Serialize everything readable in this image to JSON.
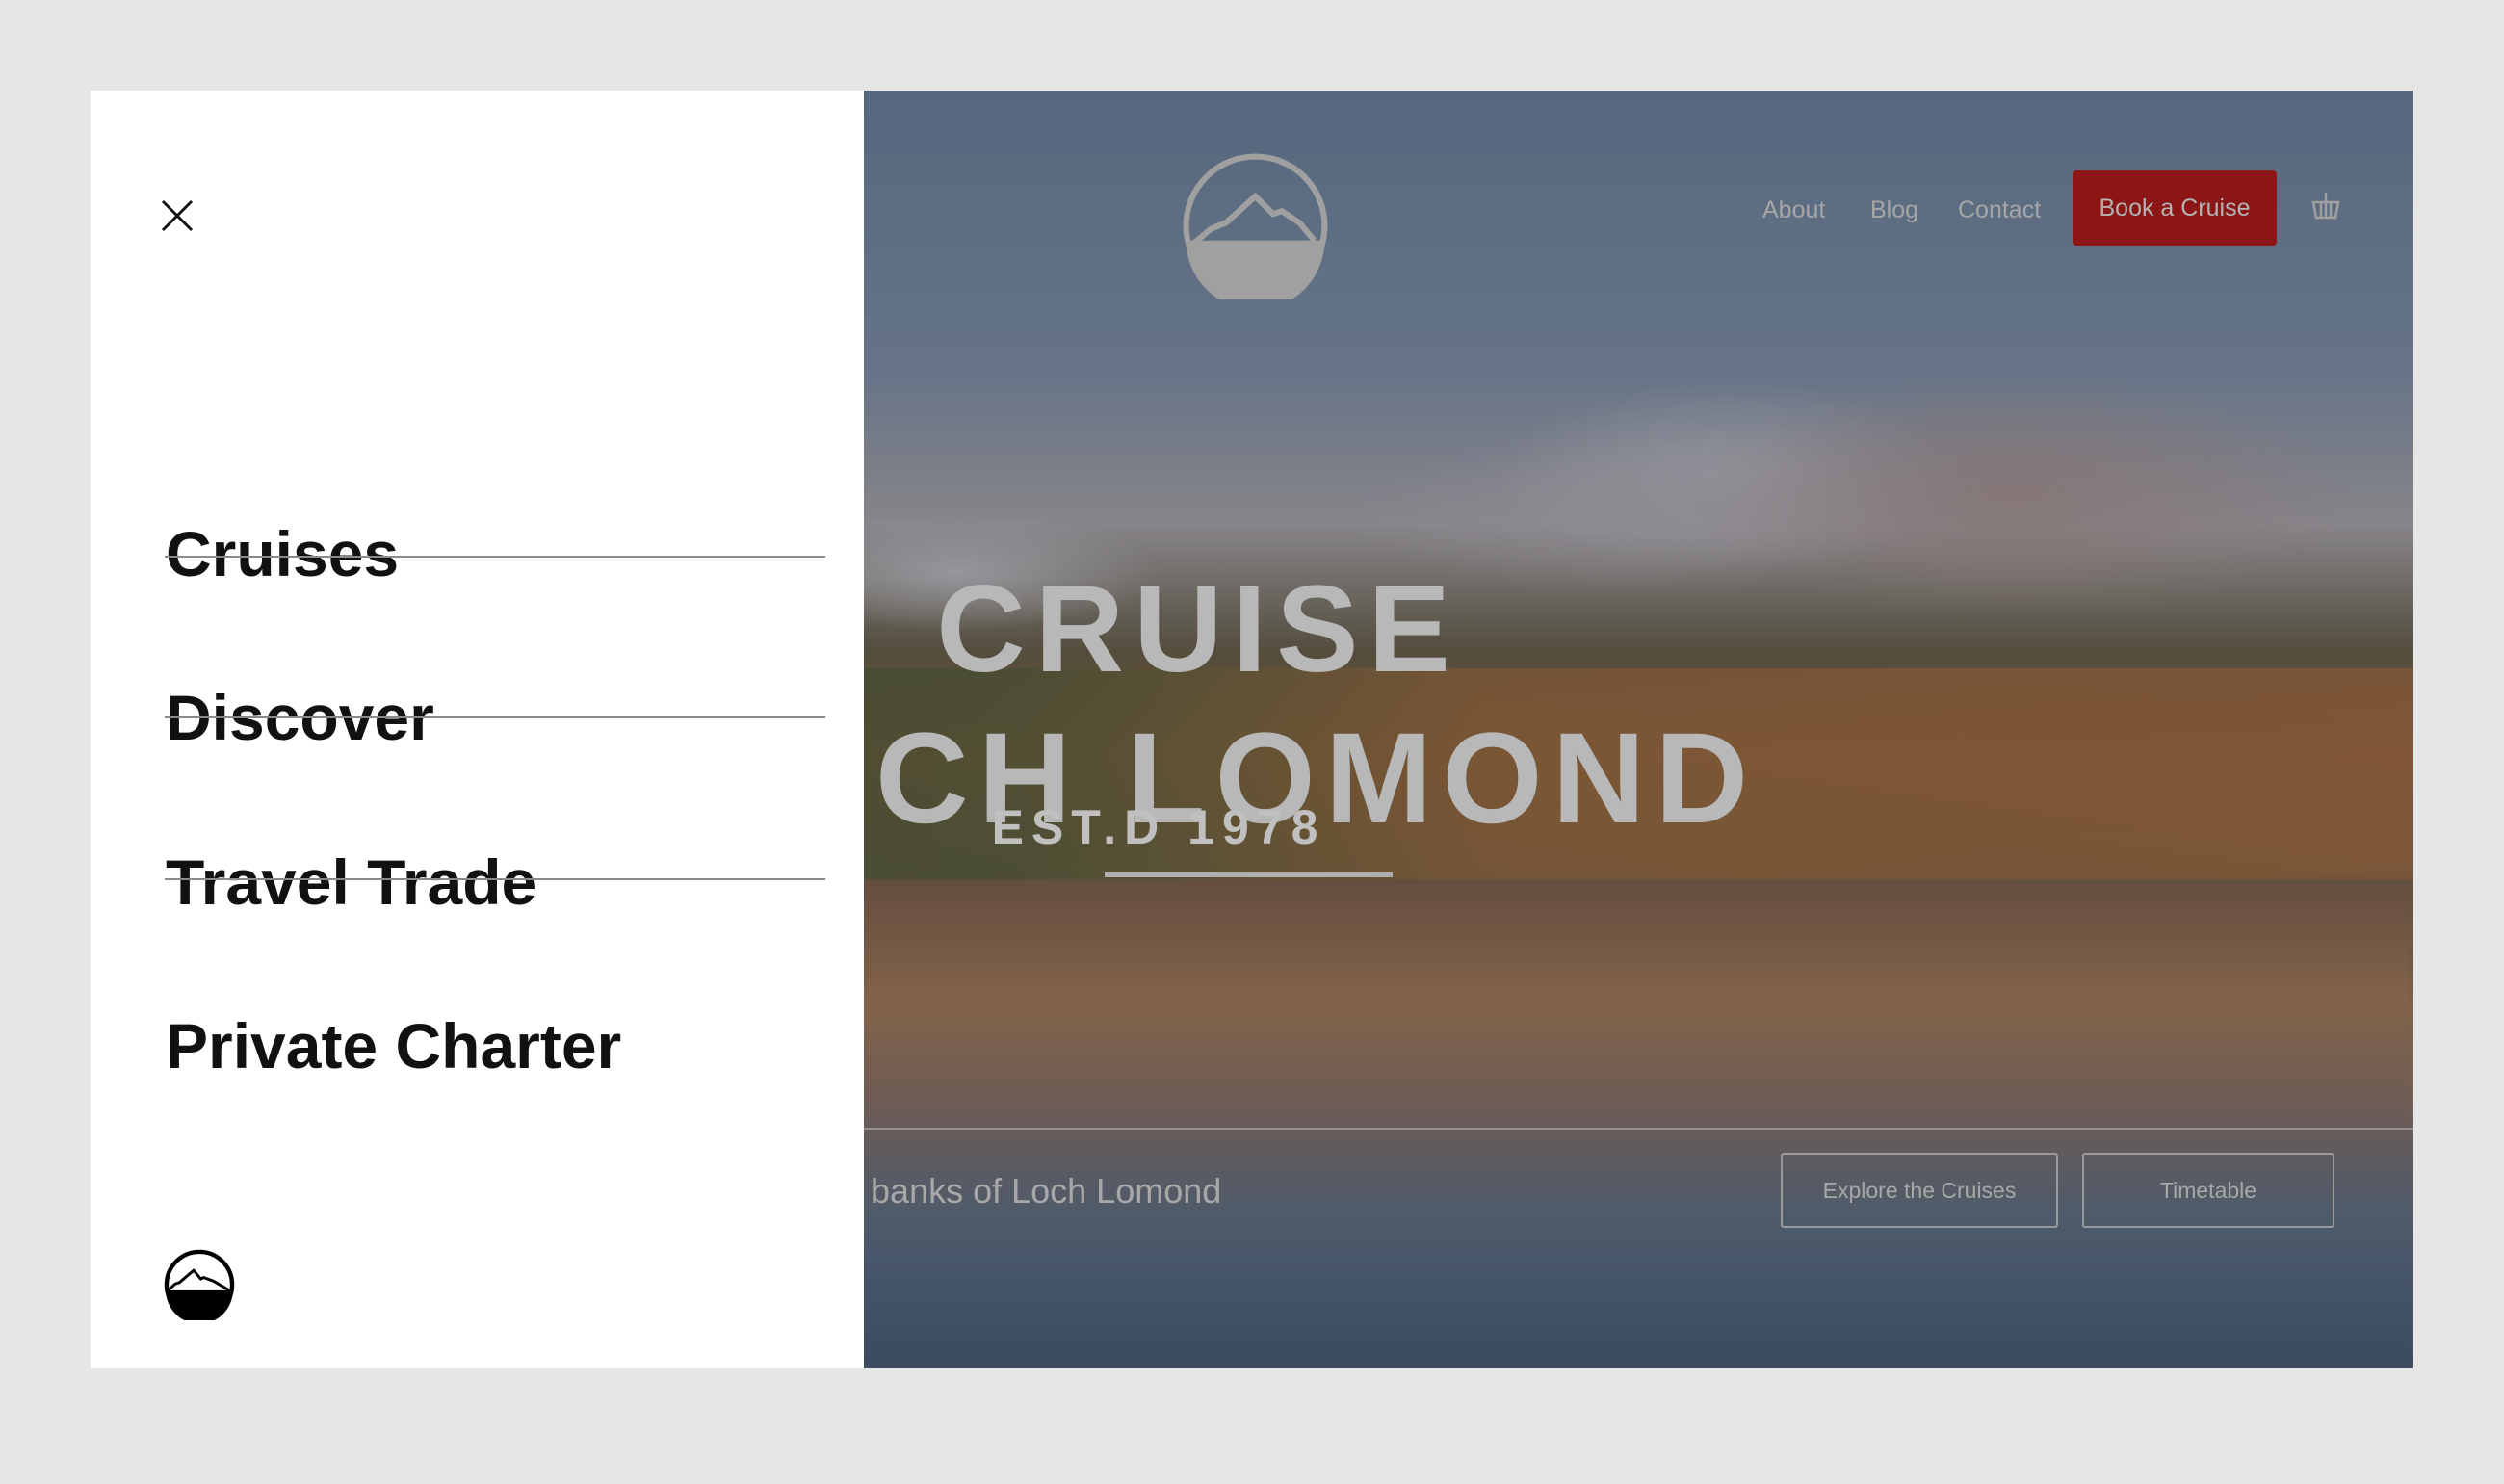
{
  "menu": {
    "items": [
      {
        "label": "Cruises"
      },
      {
        "label": "Discover"
      },
      {
        "label": "Travel Trade"
      },
      {
        "label": "Private Charter"
      }
    ]
  },
  "nav": {
    "about": "About",
    "blog": "Blog",
    "contact": "Contact",
    "book": "Book a Cruise"
  },
  "hero": {
    "line1": "CRUISE",
    "line2": "LOCH LOMOND",
    "est": "EST.D 1978",
    "tagline": "e banks of Loch Lomond",
    "explore": "Explore the Cruises",
    "timetable": "Timetable"
  },
  "colors": {
    "accent": "#8c1515",
    "menu_bg": "#ffffff",
    "page_bg": "#e6e6e6"
  },
  "icons": {
    "close": "close-icon",
    "basket": "basket-icon",
    "logo": "mountain-logo-icon"
  }
}
